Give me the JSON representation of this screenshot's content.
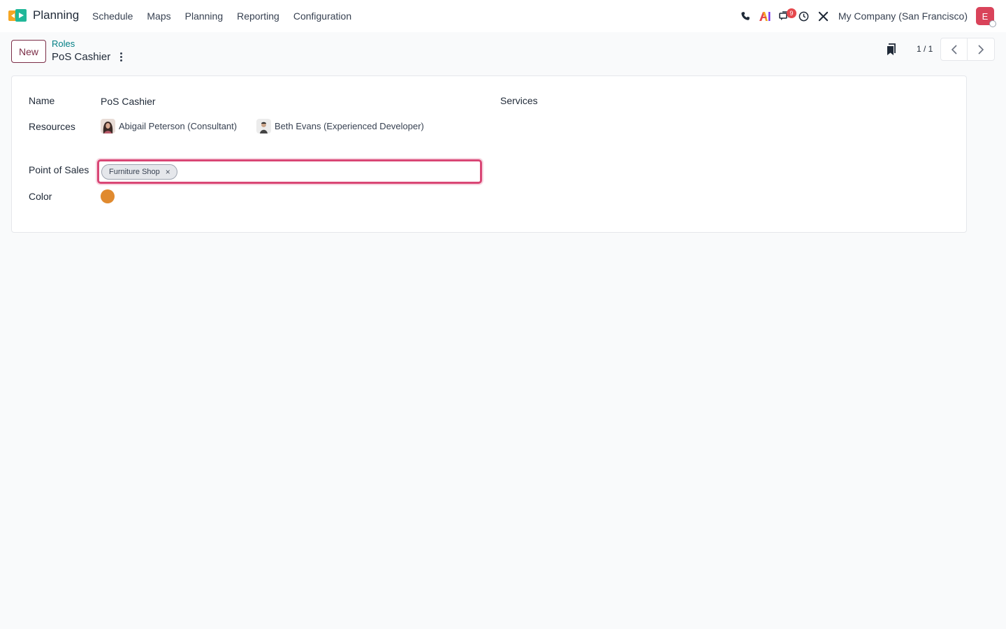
{
  "navbar": {
    "app_name": "Planning",
    "menu": [
      {
        "label": "Schedule"
      },
      {
        "label": "Maps"
      },
      {
        "label": "Planning"
      },
      {
        "label": "Reporting"
      },
      {
        "label": "Configuration"
      }
    ],
    "systray": {
      "icons": [
        "phone-icon",
        "ai-icon",
        "chat-icon",
        "clock-icon",
        "tools-icon"
      ],
      "messages_badge": "9",
      "company": "My Company (San Francisco)",
      "user_initial": "E",
      "user_avatar_color": "#d9435a"
    }
  },
  "control_panel": {
    "new_label": "New",
    "breadcrumb_parent": "Roles",
    "record_title": "PoS Cashier",
    "pager_value": "1 / 1"
  },
  "form": {
    "name_label": "Name",
    "name_value": "PoS Cashier",
    "resources_label": "Resources",
    "resources": [
      {
        "name": "Abigail Peterson (Consultant)"
      },
      {
        "name": "Beth Evans (Experienced Developer)"
      }
    ],
    "services_label": "Services",
    "pos_label": "Point of Sales",
    "pos_tags": [
      {
        "label": "Furniture Shop"
      }
    ],
    "color_label": "Color",
    "color_value": "#e08a2f"
  },
  "theme": {
    "accent": "#7b2d47",
    "link": "#017e84",
    "focus_border": "#d94675"
  }
}
